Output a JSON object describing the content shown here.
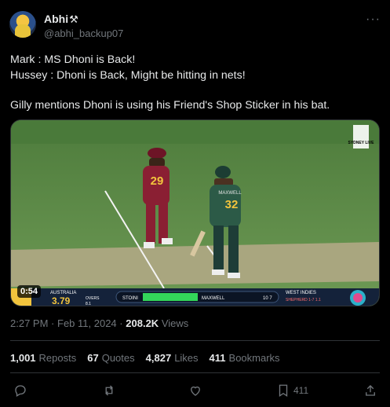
{
  "author": {
    "display_name": "Abhi",
    "badge_icon": "hammer-pick-icon",
    "handle": "@abhi_backup07"
  },
  "tweet": {
    "lines": [
      "Mark : MS Dhoni is Back!",
      "Hussey : Dhoni is Back, Might be hitting in nets!",
      "Gilly mentions Dhoni is using his Friend's Shop Sticker in his bat."
    ]
  },
  "video": {
    "duration": "0:54",
    "broadcast_logo": "SYDNEY LIVE",
    "scoreboard": {
      "team1": "AUSTRALIA",
      "score": "3.79",
      "overs_label": "OVERS",
      "overs": "8.1",
      "batter1": "STOINI",
      "batter2": "MAXWELL",
      "batter2_score": "10 7",
      "team2": "WEST INDIES",
      "bowler": "SHEPHERD 1-7 1.1"
    },
    "player_left_number": "29",
    "player_right_name": "MAXWELL",
    "player_right_number": "32"
  },
  "meta": {
    "time": "2:27 PM",
    "separator": "·",
    "date": "Feb 11, 2024",
    "views_count": "208.2K",
    "views_label": "Views"
  },
  "stats": {
    "reposts_count": "1,001",
    "reposts_label": "Reposts",
    "quotes_count": "67",
    "quotes_label": "Quotes",
    "likes_count": "4,827",
    "likes_label": "Likes",
    "bookmarks_count": "411",
    "bookmarks_label": "Bookmarks"
  },
  "actions": {
    "bookmark_count": "411"
  }
}
